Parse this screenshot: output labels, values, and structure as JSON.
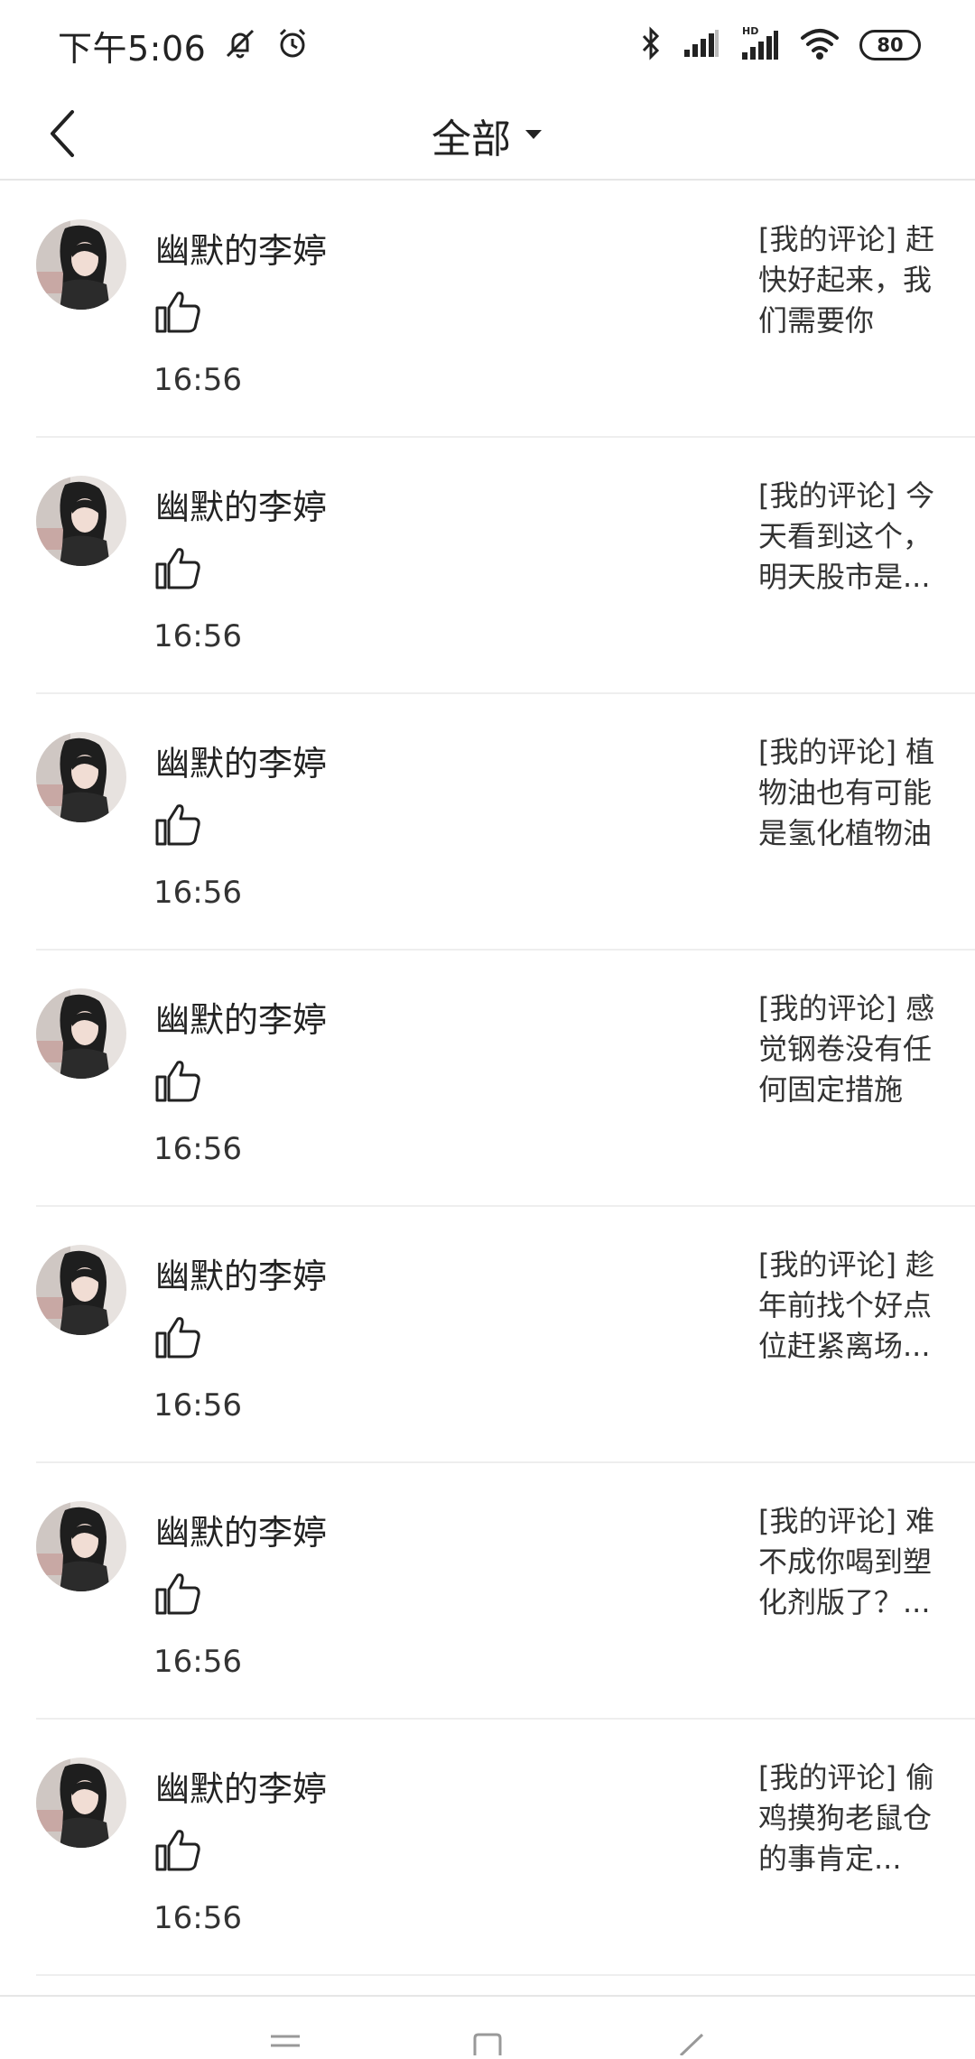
{
  "status_bar": {
    "time": "下午5:06",
    "battery": "80"
  },
  "header": {
    "title": "全部"
  },
  "items": [
    {
      "name": "幽默的李婷",
      "time": "16:56",
      "comment": "[我的评论] 赶快好起来，我们需要你"
    },
    {
      "name": "幽默的李婷",
      "time": "16:56",
      "comment": "[我的评论] 今天看到这个，明天股市是..."
    },
    {
      "name": "幽默的李婷",
      "time": "16:56",
      "comment": "[我的评论] 植物油也有可能是氢化植物油"
    },
    {
      "name": "幽默的李婷",
      "time": "16:56",
      "comment": "[我的评论] 感觉钢卷没有任何固定措施"
    },
    {
      "name": "幽默的李婷",
      "time": "16:56",
      "comment": "[我的评论] 趁年前找个好点位赶紧离场..."
    },
    {
      "name": "幽默的李婷",
      "time": "16:56",
      "comment": "[我的评论] 难不成你喝到塑化剂版了？..."
    },
    {
      "name": "幽默的李婷",
      "time": "16:56",
      "comment": "[我的评论] 偷鸡摸狗老鼠仓的事肯定..."
    }
  ],
  "icons": {
    "status": [
      "mute-icon",
      "alarm-icon",
      "bluetooth-icon",
      "signal-icon",
      "hd-signal-icon",
      "wifi-icon"
    ],
    "header": [
      "back-icon",
      "dropdown-caret-icon"
    ],
    "row": [
      "avatar",
      "thumbs-up-icon"
    ],
    "system_nav": [
      "menu-icon",
      "home-icon",
      "back-nav-icon"
    ]
  }
}
